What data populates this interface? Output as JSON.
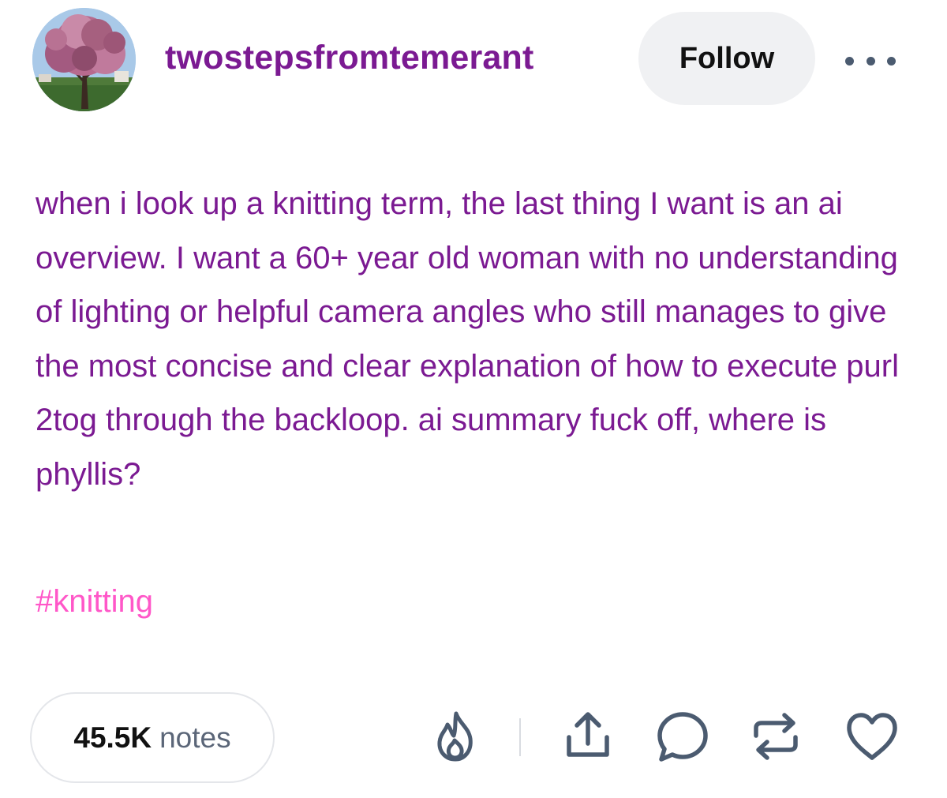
{
  "post": {
    "author": {
      "username": "twostepsfromtemerant",
      "avatar_icon": "avatar-blossom-tree"
    },
    "follow_label": "Follow",
    "more_icon": "more-options-icon",
    "body": "when i look up a knitting term, the last thing I want is an ai overview. I want a 60+ year old woman with no understanding of lighting or helpful camera angles who still manages to give the most concise and clear explanation of how to execute purl 2tog through the backloop. ai summary fuck off, where is phyllis?",
    "tags": [
      "#knitting"
    ],
    "notes": {
      "count": "45.5K",
      "label": "notes"
    },
    "actions": [
      {
        "name": "blaze-icon"
      },
      {
        "name": "share-icon"
      },
      {
        "name": "reply-icon"
      },
      {
        "name": "reblog-icon"
      },
      {
        "name": "like-icon"
      }
    ]
  },
  "colors": {
    "username": "#7b1a92",
    "body_text": "#7b1a92",
    "tag": "#ff57c8",
    "icon": "#4b5b70",
    "follow_bg": "#f0f1f3"
  }
}
